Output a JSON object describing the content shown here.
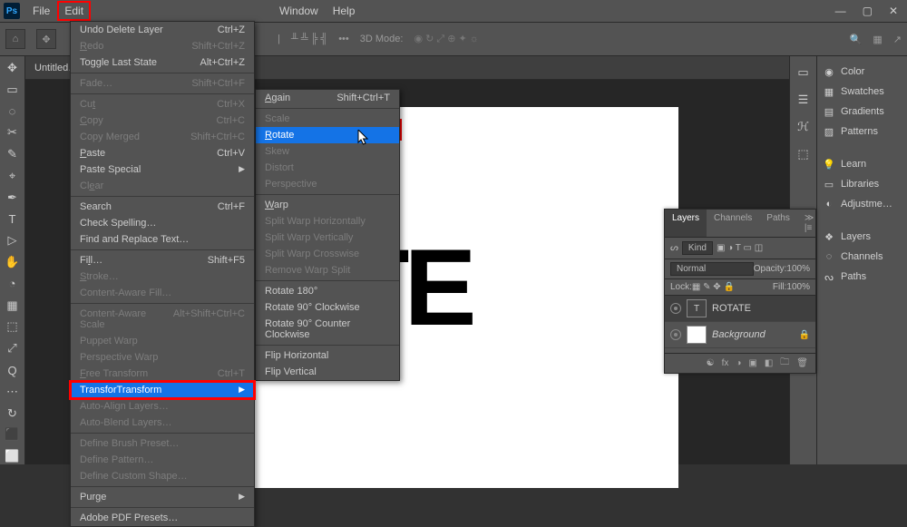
{
  "menubar": {
    "ps": "Ps",
    "items": [
      "File",
      "Edit",
      "Window",
      "Help"
    ]
  },
  "window_controls": {
    "min": "—",
    "max": "▢",
    "close": "✕"
  },
  "option_bar": {
    "home": "⌂",
    "move": "✥",
    "label1": "—",
    "mode3d": "3D Mode:",
    "dots": "•••"
  },
  "left_tools": [
    "✥",
    "▭",
    "◌",
    "✂",
    "✎",
    "⌖",
    "✒",
    "T",
    "▷",
    "✋",
    "◔",
    "▦",
    "⬚",
    "⤢",
    "Q",
    "⋯",
    "↻",
    "⬛",
    "⬜"
  ],
  "doc_tab": "Untitled…",
  "canvas_text": "TATE",
  "right_rail": [
    "▭",
    "☰",
    "ℋ",
    "⬚"
  ],
  "panels": {
    "rows": [
      {
        "icon": "◉",
        "label": "Color"
      },
      {
        "icon": "▦",
        "label": "Swatches"
      },
      {
        "icon": "▤",
        "label": "Gradients"
      },
      {
        "icon": "▨",
        "label": "Patterns"
      },
      {
        "sep": true
      },
      {
        "icon": "💡",
        "label": "Learn"
      },
      {
        "icon": "▭",
        "label": "Libraries"
      },
      {
        "icon": "◐",
        "label": "Adjustme…"
      },
      {
        "sep": true
      },
      {
        "icon": "❖",
        "label": "Layers"
      },
      {
        "icon": "◌",
        "label": "Channels"
      },
      {
        "icon": "ᔓ",
        "label": "Paths"
      }
    ]
  },
  "edit_menu": {
    "groups": [
      [
        {
          "label": "Undo Delete Layer",
          "shortcut": "Ctrl+Z"
        },
        {
          "label": "Redo",
          "shortcut": "Shift+Ctrl+Z",
          "disabled": true,
          "u": "R"
        },
        {
          "label": "Toggle Last State",
          "shortcut": "Alt+Ctrl+Z"
        }
      ],
      [
        {
          "label": "Fade…",
          "shortcut": "Shift+Ctrl+F",
          "disabled": true
        }
      ],
      [
        {
          "label": "Cut",
          "shortcut": "Ctrl+X",
          "disabled": true,
          "u": "t"
        },
        {
          "label": "Copy",
          "shortcut": "Ctrl+C",
          "disabled": true,
          "u": "C"
        },
        {
          "label": "Copy Merged",
          "shortcut": "Shift+Ctrl+C",
          "disabled": true
        },
        {
          "label": "Paste",
          "shortcut": "Ctrl+V",
          "u": "P"
        },
        {
          "label": "Paste Special",
          "arrow": true
        },
        {
          "label": "Clear",
          "disabled": true,
          "u": "e"
        }
      ],
      [
        {
          "label": "Search",
          "shortcut": "Ctrl+F"
        },
        {
          "label": "Check Spelling…"
        },
        {
          "label": "Find and Replace Text…"
        }
      ],
      [
        {
          "label": "Fill…",
          "shortcut": "Shift+F5",
          "u": "l"
        },
        {
          "label": "Stroke…",
          "disabled": true,
          "u": "S"
        },
        {
          "label": "Content-Aware Fill…",
          "disabled": true
        }
      ],
      [
        {
          "label": "Content-Aware Scale",
          "shortcut": "Alt+Shift+Ctrl+C",
          "disabled": true
        },
        {
          "label": "Puppet Warp",
          "disabled": true
        },
        {
          "label": "Perspective Warp",
          "disabled": true
        },
        {
          "label": "Free Transform",
          "shortcut": "Ctrl+T",
          "disabled": true,
          "u": "F"
        },
        {
          "label": "Transform",
          "arrow": true,
          "selected": true,
          "u": "A",
          "red": true
        },
        {
          "label": "Auto-Align Layers…",
          "disabled": true
        },
        {
          "label": "Auto-Blend Layers…",
          "disabled": true
        }
      ],
      [
        {
          "label": "Define Brush Preset…",
          "disabled": true
        },
        {
          "label": "Define Pattern…",
          "disabled": true
        },
        {
          "label": "Define Custom Shape…",
          "disabled": true
        }
      ],
      [
        {
          "label": "Purge",
          "arrow": true,
          "u": "g"
        }
      ],
      [
        {
          "label": "Adobe PDF Presets…"
        }
      ]
    ]
  },
  "transform_submenu": {
    "groups": [
      [
        {
          "label": "Again",
          "shortcut": "Shift+Ctrl+T",
          "u": "A"
        }
      ],
      [
        {
          "label": "Scale",
          "disabled": true
        },
        {
          "label": "Rotate",
          "selected": true,
          "red": true,
          "u": "R"
        },
        {
          "label": "Skew",
          "disabled": true
        },
        {
          "label": "Distort",
          "disabled": true
        },
        {
          "label": "Perspective",
          "disabled": true
        }
      ],
      [
        {
          "label": "Warp",
          "u": "W"
        },
        {
          "label": "Split Warp Horizontally",
          "disabled": true
        },
        {
          "label": "Split Warp Vertically",
          "disabled": true
        },
        {
          "label": "Split Warp Crosswise",
          "disabled": true
        },
        {
          "label": "Remove Warp Split",
          "disabled": true
        }
      ],
      [
        {
          "label": "Rotate 180°"
        },
        {
          "label": "Rotate 90° Clockwise"
        },
        {
          "label": "Rotate 90° Counter Clockwise"
        }
      ],
      [
        {
          "label": "Flip Horizontal"
        },
        {
          "label": "Flip Vertical"
        }
      ]
    ]
  },
  "layers_panel": {
    "tabs": [
      "Layers",
      "Channels",
      "Paths"
    ],
    "kind_label": "Kind",
    "kind_icons": [
      "▣",
      "◑",
      "T",
      "▭",
      "◫"
    ],
    "blend": "Normal",
    "opacity_label": "Opacity:",
    "opacity_value": "100%",
    "lock_label": "Lock:",
    "lock_icons": [
      "▦",
      "✎",
      "✥",
      "🔒"
    ],
    "fill_label": "Fill:",
    "fill_value": "100%",
    "layers": [
      {
        "type": "T",
        "name": "ROTATE",
        "selected": true
      },
      {
        "type": "bg",
        "name": "Background",
        "locked": true,
        "italic": true
      }
    ],
    "footer_icons": [
      "☯",
      "fx",
      "◑",
      "▣",
      "◧",
      "🗀",
      "🗑"
    ]
  },
  "meta": {
    "tabs_end": "≫ |≡",
    "search_icon": "🔍",
    "grid_icon": "▦",
    "share_icon": "↗"
  }
}
